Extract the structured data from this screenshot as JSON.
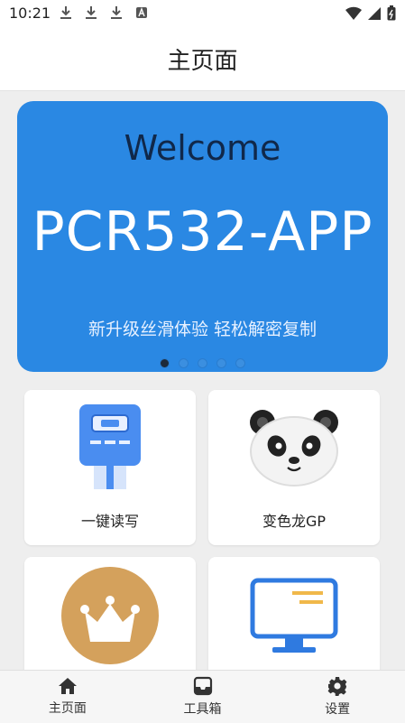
{
  "status": {
    "time": "10:21"
  },
  "header": {
    "title": "主页面"
  },
  "banner": {
    "welcome": "Welcome",
    "app_name": "PCR532-APP",
    "subtitle": "新升级丝滑体验 轻松解密复制",
    "dots": 5,
    "active_dot": 0
  },
  "tiles": [
    {
      "label": "一键读写",
      "icon": "card-reader-icon"
    },
    {
      "label": "变色龙GP",
      "icon": "panda-icon"
    },
    {
      "label": "",
      "icon": "crown-icon"
    },
    {
      "label": "",
      "icon": "monitor-icon"
    }
  ],
  "nav": {
    "items": [
      {
        "label": "主页面",
        "icon": "home-icon"
      },
      {
        "label": "工具箱",
        "icon": "toolbox-icon"
      },
      {
        "label": "设置",
        "icon": "gear-icon"
      }
    ]
  },
  "colors": {
    "banner": "#2a88e3",
    "accent_blue": "#4a8df0",
    "crown_bg": "#d4a15c"
  }
}
